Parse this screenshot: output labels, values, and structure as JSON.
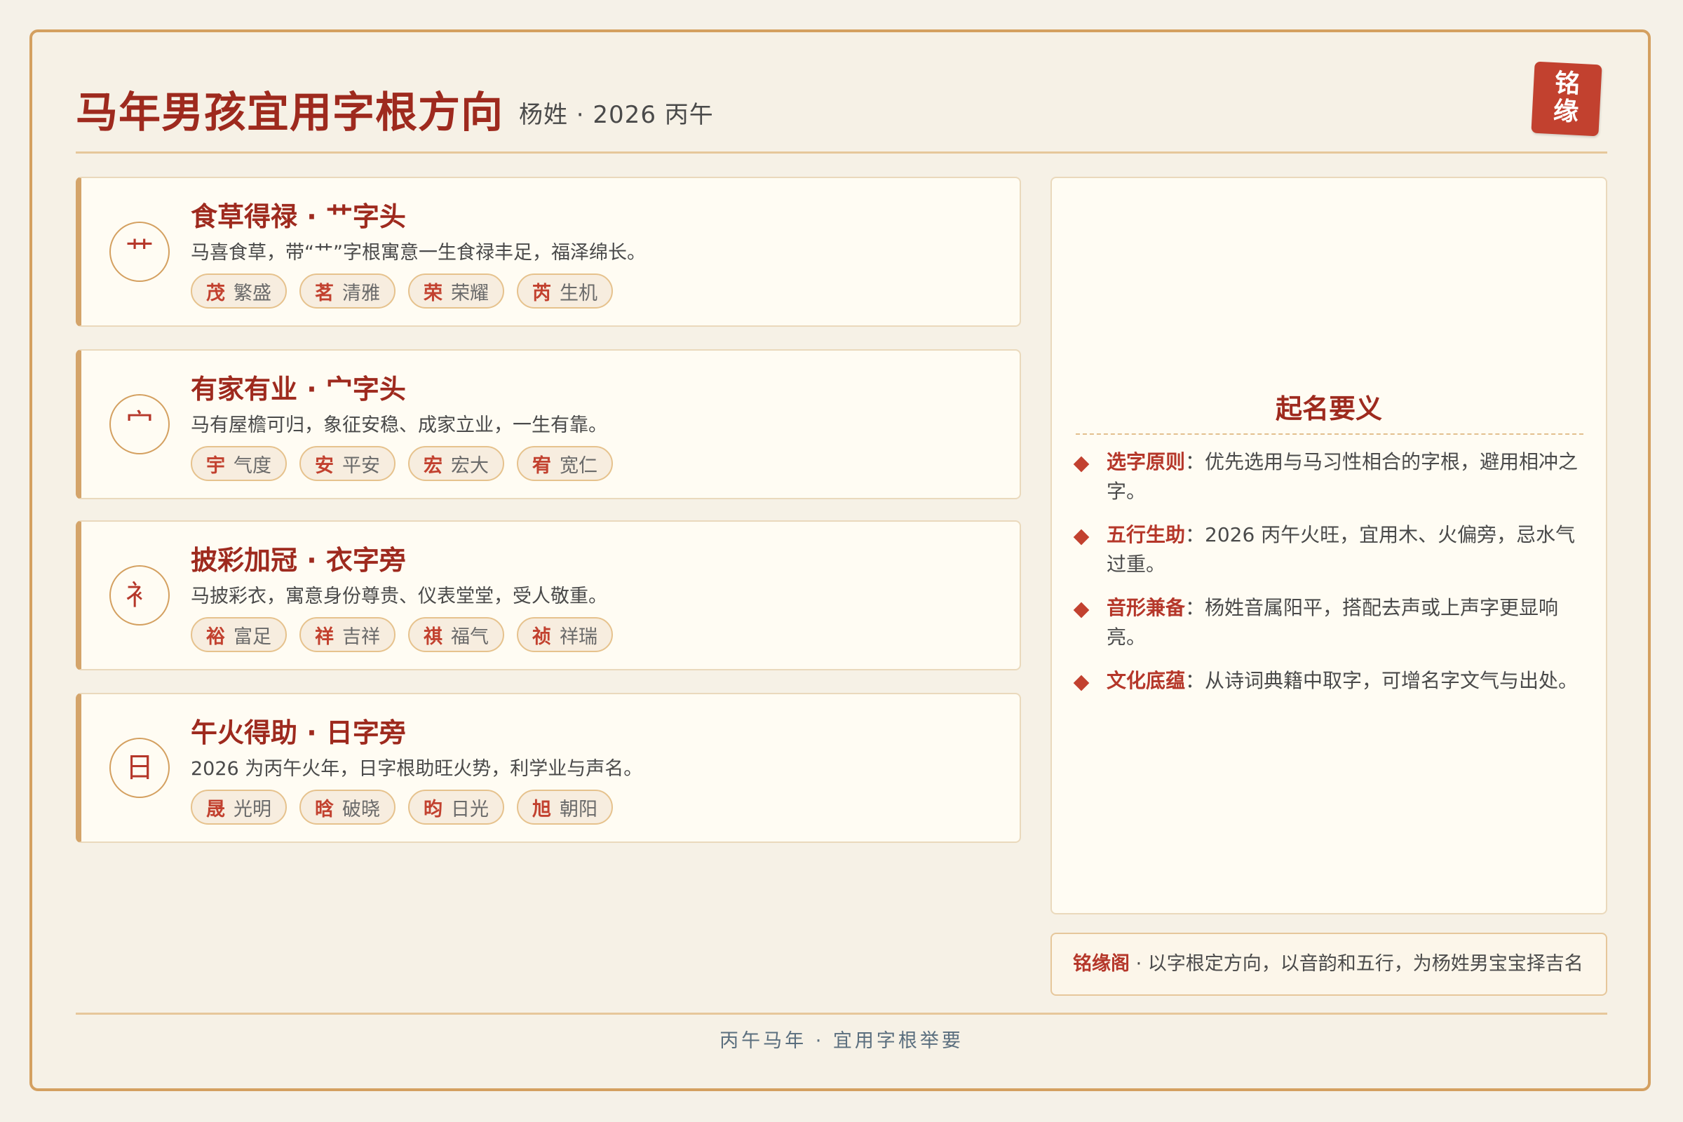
{
  "header": {
    "title": "马年男孩宜用字根方向",
    "subtitle": "杨姓 · 2026 丙午",
    "seal_chars": [
      "铭",
      "缘"
    ]
  },
  "roots": [
    {
      "icon": "艹",
      "title": "食草得禄 · 艹字头",
      "desc": "马喜食草，带“艹”字根寓意一生食禄丰足，福泽绵长。",
      "chips": [
        {
          "char": "茂",
          "meaning": "繁盛"
        },
        {
          "char": "茗",
          "meaning": "清雅"
        },
        {
          "char": "荣",
          "meaning": "荣耀"
        },
        {
          "char": "芮",
          "meaning": "生机"
        }
      ]
    },
    {
      "icon": "宀",
      "title": "有家有业 · 宀字头",
      "desc": "马有屋檐可归，象征安稳、成家立业，一生有靠。",
      "chips": [
        {
          "char": "宇",
          "meaning": "气度"
        },
        {
          "char": "安",
          "meaning": "平安"
        },
        {
          "char": "宏",
          "meaning": "宏大"
        },
        {
          "char": "宥",
          "meaning": "宽仁"
        }
      ]
    },
    {
      "icon": "衤",
      "title": "披彩加冠 · 衣字旁",
      "desc": "马披彩衣，寓意身份尊贵、仪表堂堂，受人敬重。",
      "chips": [
        {
          "char": "裕",
          "meaning": "富足"
        },
        {
          "char": "祥",
          "meaning": "吉祥"
        },
        {
          "char": "祺",
          "meaning": "福气"
        },
        {
          "char": "祯",
          "meaning": "祥瑞"
        }
      ]
    },
    {
      "icon": "日",
      "title": "午火得助 · 日字旁",
      "desc": "2026 为丙午火年，日字根助旺火势，利学业与声名。",
      "chips": [
        {
          "char": "晟",
          "meaning": "光明"
        },
        {
          "char": "晗",
          "meaning": "破晓"
        },
        {
          "char": "昀",
          "meaning": "日光"
        },
        {
          "char": "旭",
          "meaning": "朝阳"
        }
      ]
    }
  ],
  "panel": {
    "title": "起名要义",
    "principles": [
      {
        "label": "选字原则",
        "text": "：优先选用与马习性相合的字根，避用相冲之字。"
      },
      {
        "label": "五行生助",
        "text": "：2026 丙午火旺，宜用木、火偏旁，忌水气过重。"
      },
      {
        "label": "音形兼备",
        "text": "：杨姓音属阳平，搭配去声或上声字更显响亮。"
      },
      {
        "label": "文化底蕴",
        "text": "：从诗词典籍中取字，可增名字文气与出处。"
      }
    ]
  },
  "footer_note": {
    "brand": "铭缘阁",
    "text": " · 以字根定方向，以音韵和五行，为杨姓男宝宝择吉名"
  },
  "footer_caption": "丙午马年 · 宜用字根举要",
  "colors": {
    "accent": "#9e2a1e",
    "seal": "#c2412f",
    "border": "#d4a060",
    "background": "#f6f1e6"
  }
}
